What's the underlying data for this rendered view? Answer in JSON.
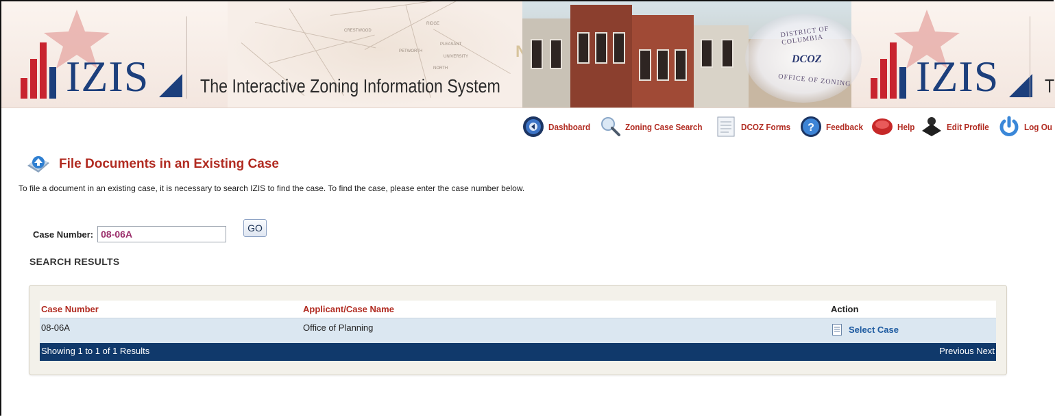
{
  "banner": {
    "logo_text": "IZIS",
    "title": "The Interactive Zoning Information System",
    "title_repeat_fragment": "Tl",
    "seal_top": "DISTRICT OF COLUMBIA",
    "seal_center": "DCOZ",
    "seal_bottom": "OFFICE OF ZONING",
    "map_quadrant": "NW"
  },
  "nav": {
    "items": [
      {
        "label": "Dashboard",
        "icon": "dashboard-icon"
      },
      {
        "label": "Zoning Case Search",
        "icon": "magnifier-icon"
      },
      {
        "label": "DCOZ Forms",
        "icon": "forms-icon"
      },
      {
        "label": "Feedback",
        "icon": "question-icon"
      },
      {
        "label": "Help",
        "icon": "help-buoy-icon"
      },
      {
        "label": "Edit Profile",
        "icon": "profile-icon"
      },
      {
        "label": "Log Ou",
        "icon": "power-icon"
      }
    ]
  },
  "page": {
    "title": "File Documents in an Existing Case",
    "intro": "To file a document in an existing case, it is necessary to search IZIS to find the case. To find the case, please enter the case number below."
  },
  "search": {
    "label": "Case Number:",
    "value": "08-06A",
    "go_label": "GO",
    "results_heading": "SEARCH RESULTS"
  },
  "results": {
    "columns": [
      "Case Number",
      "Applicant/Case Name",
      "Action"
    ],
    "rows": [
      {
        "case_number": "08-06A",
        "name": "Office of Planning",
        "action": "Select Case"
      }
    ],
    "footer": "Showing 1 to 1 of 1 Results",
    "previous": "Previous",
    "next": "Next"
  },
  "colors": {
    "accent_red": "#b12b21",
    "logo_blue": "#1c3f7c",
    "footer_navy": "#10396b",
    "row_blue": "#dbe7f1"
  }
}
